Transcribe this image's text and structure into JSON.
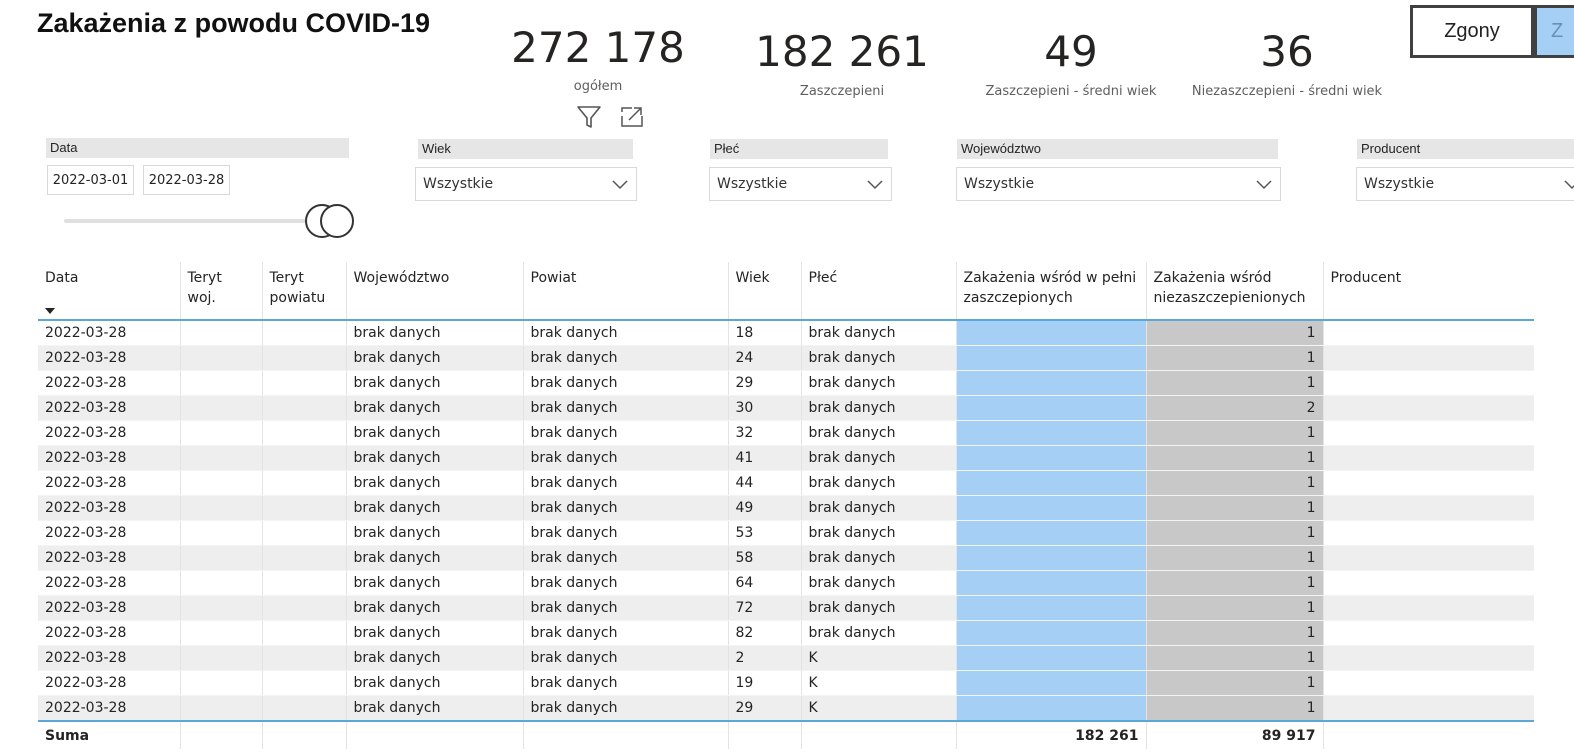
{
  "page": {
    "title": "Zakażenia z powodu COVID-19"
  },
  "kpis": [
    {
      "value": "272 178",
      "label": "ogółem"
    },
    {
      "value": "182 261",
      "label": "Zaszczepieni"
    },
    {
      "value": "49",
      "label": "Zaszczepieni - średni wiek"
    },
    {
      "value": "36",
      "label": "Niezaszczepieni - średni wiek"
    }
  ],
  "kpi_icons": [
    "filter-icon",
    "focus-mode-icon"
  ],
  "nav_buttons": {
    "zgony": "Zgony",
    "second": "Z"
  },
  "slicers": {
    "data": {
      "label": "Data",
      "from": "2022-03-01",
      "to": "2022-03-28"
    },
    "wiek": {
      "label": "Wiek",
      "value": "Wszystkie"
    },
    "plec": {
      "label": "Płeć",
      "value": "Wszystkie"
    },
    "wojewodztwo": {
      "label": "Województwo",
      "value": "Wszystkie"
    },
    "producent": {
      "label": "Producent",
      "value": "Wszystkie"
    }
  },
  "colors": {
    "accent_line": "#5aa7d8",
    "full_vaccinated_fill": "#a6cff5",
    "unvaccinated_fill": "#c8c8c8"
  },
  "table": {
    "columns": [
      "Data",
      "Teryt woj.",
      "Teryt powiatu",
      "Województwo",
      "Powiat",
      "Wiek",
      "Płeć",
      "Zakażenia wśród w pełni zaszczepionych",
      "Zakażenia wśród niezaszczepienionych",
      "Producent"
    ],
    "rows": [
      [
        "2022-03-28",
        "",
        "",
        "brak danych",
        "brak danych",
        "18",
        "brak danych",
        "",
        "1",
        ""
      ],
      [
        "2022-03-28",
        "",
        "",
        "brak danych",
        "brak danych",
        "24",
        "brak danych",
        "",
        "1",
        ""
      ],
      [
        "2022-03-28",
        "",
        "",
        "brak danych",
        "brak danych",
        "29",
        "brak danych",
        "",
        "1",
        ""
      ],
      [
        "2022-03-28",
        "",
        "",
        "brak danych",
        "brak danych",
        "30",
        "brak danych",
        "",
        "2",
        ""
      ],
      [
        "2022-03-28",
        "",
        "",
        "brak danych",
        "brak danych",
        "32",
        "brak danych",
        "",
        "1",
        ""
      ],
      [
        "2022-03-28",
        "",
        "",
        "brak danych",
        "brak danych",
        "41",
        "brak danych",
        "",
        "1",
        ""
      ],
      [
        "2022-03-28",
        "",
        "",
        "brak danych",
        "brak danych",
        "44",
        "brak danych",
        "",
        "1",
        ""
      ],
      [
        "2022-03-28",
        "",
        "",
        "brak danych",
        "brak danych",
        "49",
        "brak danych",
        "",
        "1",
        ""
      ],
      [
        "2022-03-28",
        "",
        "",
        "brak danych",
        "brak danych",
        "53",
        "brak danych",
        "",
        "1",
        ""
      ],
      [
        "2022-03-28",
        "",
        "",
        "brak danych",
        "brak danych",
        "58",
        "brak danych",
        "",
        "1",
        ""
      ],
      [
        "2022-03-28",
        "",
        "",
        "brak danych",
        "brak danych",
        "64",
        "brak danych",
        "",
        "1",
        ""
      ],
      [
        "2022-03-28",
        "",
        "",
        "brak danych",
        "brak danych",
        "72",
        "brak danych",
        "",
        "1",
        ""
      ],
      [
        "2022-03-28",
        "",
        "",
        "brak danych",
        "brak danych",
        "82",
        "brak danych",
        "",
        "1",
        ""
      ],
      [
        "2022-03-28",
        "",
        "",
        "brak danych",
        "brak danych",
        "2",
        "K",
        "",
        "1",
        ""
      ],
      [
        "2022-03-28",
        "",
        "",
        "brak danych",
        "brak danych",
        "19",
        "K",
        "",
        "1",
        ""
      ],
      [
        "2022-03-28",
        "",
        "",
        "brak danych",
        "brak danych",
        "29",
        "K",
        "",
        "1",
        ""
      ]
    ],
    "total": {
      "label": "Suma",
      "full": "182 261",
      "unvaccinated": "89 917"
    }
  }
}
